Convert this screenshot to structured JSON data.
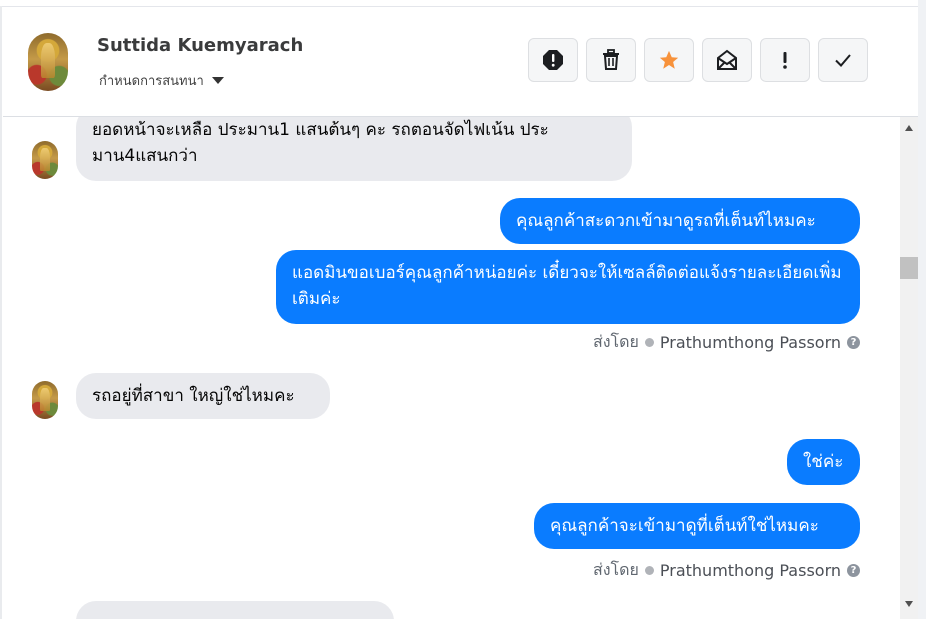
{
  "header": {
    "contact_name": "Suttida Kuemyarach",
    "assign_label": "กำหนดการสนทนา",
    "actions": [
      {
        "icon": "alert-octagon-icon",
        "label": "Mark as spam"
      },
      {
        "icon": "trash-icon",
        "label": "Delete"
      },
      {
        "icon": "star-icon",
        "label": "Star",
        "color": "#f7923b"
      },
      {
        "icon": "mark-unread-icon",
        "label": "Mark as unread"
      },
      {
        "icon": "exclamation-icon",
        "label": "Follow up"
      },
      {
        "icon": "check-icon",
        "label": "Done"
      }
    ]
  },
  "messages": [
    {
      "direction": "in",
      "text": "ยอดหน้าจะเหลือ ประมาน1 แสนต้นๆ คะ  รถตอนจัดไฟเน้น ประมาน4แสนกว่า"
    },
    {
      "direction": "out",
      "text": "คุณลูกค้าสะดวกเข้ามาดูรถที่เต็นท์ไหมคะ"
    },
    {
      "direction": "out",
      "text": "แอดมินขอเบอร์คุณลูกค้าหน่อยค่ะ  เดี๋ยวจะให้เซลล์ติดต่อแจ้งรายละเอียดเพิ่มเติมค่ะ"
    },
    {
      "direction": "in",
      "text": "รถอยู่ที่สาขา ใหญ่ใช่ไหมคะ"
    },
    {
      "direction": "out",
      "text": "ใช่ค่ะ"
    },
    {
      "direction": "out",
      "text": "คุณลูกค้าจะเข้ามาดูที่เต็นท์ใช่ไหมคะ"
    }
  ],
  "sent_by": {
    "prefix": "ส่งโดย",
    "agent": "Prathumthong Passorn",
    "help": "?"
  },
  "colors": {
    "outgoing_bubble": "#0a7cff",
    "incoming_bubble": "#e9eaee",
    "star": "#f7923b"
  }
}
